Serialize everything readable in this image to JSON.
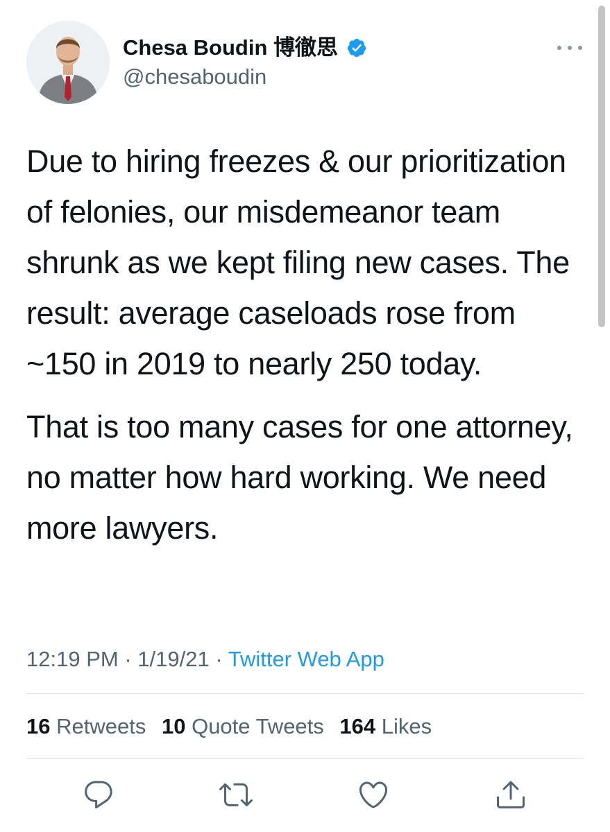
{
  "author": {
    "display_name": "Chesa Boudin 博徹思",
    "handle": "@chesaboudin",
    "verified": true
  },
  "tweet": {
    "paragraphs": [
      "Due to hiring freezes & our prioritization of felonies, our misdemeanor team shrunk as we kept filing new cases. The result: average caseloads rose from ~150 in 2019 to nearly 250 today.",
      "That is too many cases for one attorney, no matter how hard working. We need more lawyers."
    ],
    "time": "12:19 PM",
    "date": "1/19/21",
    "source": "Twitter Web App"
  },
  "stats": {
    "retweets_count": "16",
    "retweets_label": "Retweets",
    "quotes_count": "10",
    "quotes_label": "Quote Tweets",
    "likes_count": "164",
    "likes_label": "Likes"
  },
  "icons": {
    "verified": "verified-badge-icon",
    "more": "more-options-icon",
    "reply": "reply-icon",
    "retweet": "retweet-icon",
    "like": "heart-icon",
    "share": "share-icon"
  },
  "colors": {
    "accent": "#1d9bf0",
    "text": "#0f1419",
    "secondary": "#536471"
  }
}
